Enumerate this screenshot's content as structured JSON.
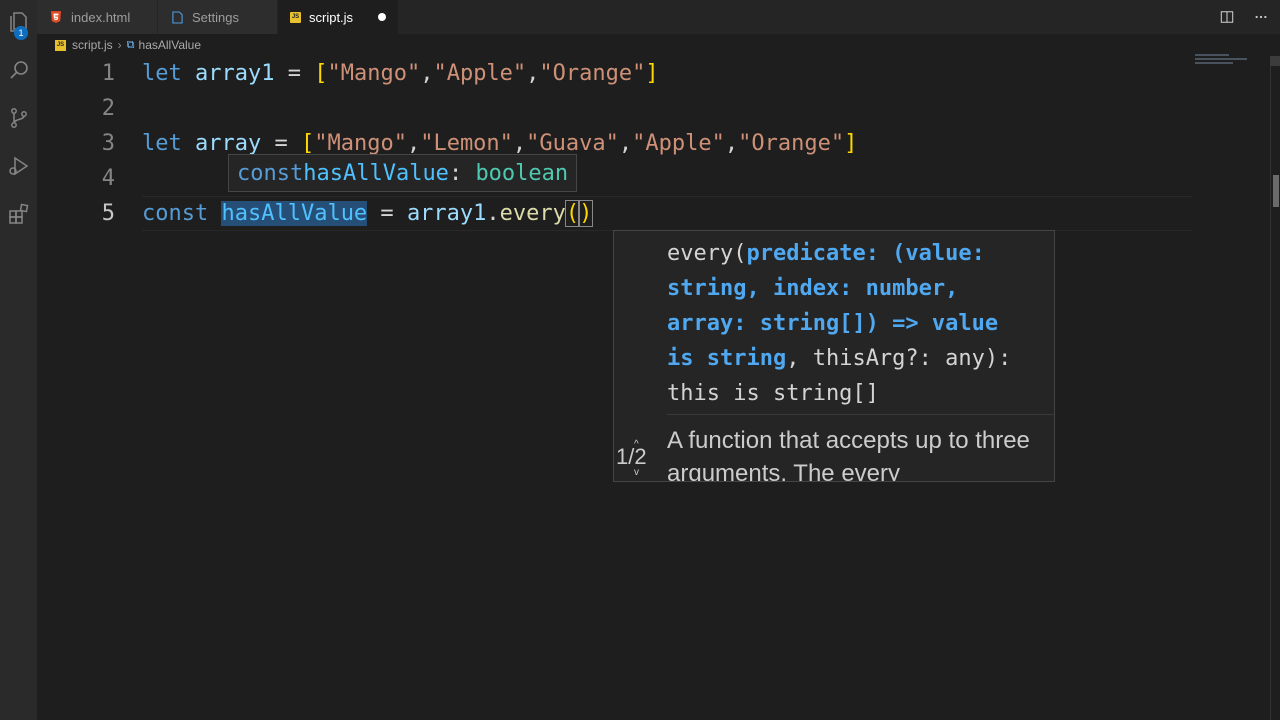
{
  "activity_bar": {
    "icons": [
      "files-icon",
      "search-icon",
      "source-control-icon",
      "run-debug-icon",
      "extensions-icon"
    ],
    "explorer_badge": "1"
  },
  "tabs": [
    {
      "label": "index.html",
      "icon": "html-file-icon"
    },
    {
      "label": "Settings",
      "icon": "settings-file-icon"
    },
    {
      "label": "script.js",
      "icon": "js-file-icon",
      "icon_text": "JS"
    }
  ],
  "breadcrumb": {
    "file": "script.js",
    "symbol": "hasAllValue"
  },
  "editor": {
    "line_numbers": [
      "1",
      "2",
      "3",
      "4",
      "5"
    ],
    "line1": {
      "kw": "let",
      "var": "array1",
      "eq": " = ",
      "open": "[",
      "s1": "\"Mango\"",
      "c1": ",",
      "s2": "\"Apple\"",
      "c2": ",",
      "s3": "\"Orange\"",
      "close": "]"
    },
    "line3": {
      "kw": "let",
      "var": "array",
      "eq": " = ",
      "open": "[",
      "s1": "\"Mango\"",
      "c1": ",",
      "s2": "\"Lemon\"",
      "c2": ",",
      "s3": "\"Guava\"",
      "c3": ",",
      "s4": "\"Apple\"",
      "c4": ",",
      "s5": "\"Orange\"",
      "close": "]"
    },
    "line5": {
      "kw": "const",
      "var": "hasAllValue",
      "eq": " = ",
      "obj": "array1",
      "dot": ".",
      "method": "every",
      "open": "(",
      "close": ")"
    }
  },
  "hover": {
    "kw": "const",
    "name": "hasAllValue",
    "colon": ": ",
    "type": "boolean"
  },
  "signature_help": {
    "line1_a": "every(",
    "line1_b": "predicate: (value:",
    "line2": "string, index: number,",
    "line3": "array: string[]) => value",
    "line4_a": "is string",
    "line4_b": ", thisArg?: any):",
    "line5": "this is string[]",
    "doc": "A function that accepts up to three arguments. The every",
    "count": "1/2"
  }
}
